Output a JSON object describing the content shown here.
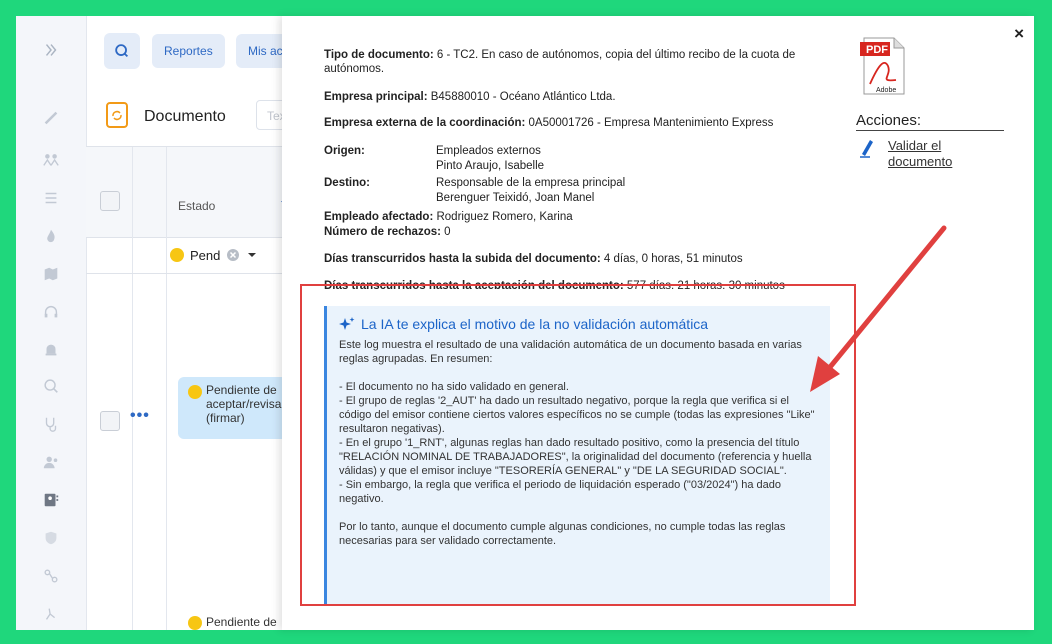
{
  "topbar": {
    "reportes_label": "Reportes",
    "mis_acciones_label": "Mis accio"
  },
  "doc_header": {
    "title": "Documento",
    "text_placeholder": "Texto"
  },
  "table": {
    "status_header": "Estado",
    "filter_value": "Pend",
    "row1_status": "Pendiente de aceptar/revisar (firmar)",
    "row2_status": "Pendiente de"
  },
  "modal": {
    "tipo_label": "Tipo de documento:",
    "tipo_value": " 6 - TC2. En caso de autónomos, copia del último recibo de la cuota de autónomos.",
    "empresa_principal_label": "Empresa principal:",
    "empresa_principal_value": " B45880010 - Océano Atlántico Ltda.",
    "empresa_externa_label": "Empresa externa de la coordinación:",
    "empresa_externa_value": " 0A50001726 - Empresa Mantenimiento Express",
    "origen_label": "Origen:",
    "origen_line1": "Empleados externos",
    "origen_line2": "Pinto Araujo, Isabelle",
    "destino_label": "Destino:",
    "destino_line1": "Responsable de la empresa principal",
    "destino_line2": "Berenguer Teixidó, Joan Manel",
    "empleado_label": "Empleado afectado:",
    "empleado_value": " Rodriguez Romero, Karina",
    "rechazos_label": "Número de rechazos:",
    "rechazos_value": " 0",
    "dias_subida_label": "Días transcurridos hasta la subida del documento:",
    "dias_subida_value": " 4 días, 0 horas, 51 minutos",
    "dias_aceptacion_label": "Días transcurridos hasta la aceptación del documento:",
    "dias_aceptacion_value": " 577 días, 21 horas, 30 minutos",
    "pdf_text": "PDF",
    "adobe_text": "Adobe",
    "acciones_title": "Acciones:",
    "validar_label": "Validar el documento",
    "close_label": "×"
  },
  "ia": {
    "title": "La IA te explica el motivo de la no validación automática",
    "body": "Este log muestra el resultado de una validación automática de un documento basada en varias reglas agrupadas. En resumen:\n\n- El documento no ha sido validado en general.\n- El grupo de reglas '2_AUT' ha dado un resultado negativo, porque la regla que verifica si el código del emisor contiene ciertos valores específicos no se cumple (todas las expresiones \"Like\" resultaron negativas).\n- En el grupo '1_RNT', algunas reglas han dado resultado positivo, como la presencia del título \"RELACIÓN NOMINAL DE TRABAJADORES\", la originalidad del documento (referencia y huella válidas) y que el emisor incluye \"TESORERÍA GENERAL\" y \"DE LA SEGURIDAD SOCIAL\".\n- Sin embargo, la regla que verifica el periodo de liquidación esperado (\"03/2024\") ha dado negativo.\n\nPor lo tanto, aunque el documento cumple algunas condiciones, no cumple todas las reglas necesarias para ser validado correctamente."
  },
  "colors": {
    "border_green": "#1fd77c",
    "accent_blue": "#1c64c8",
    "highlight_red": "#e0403f",
    "pending_yellow": "#f7c613"
  }
}
